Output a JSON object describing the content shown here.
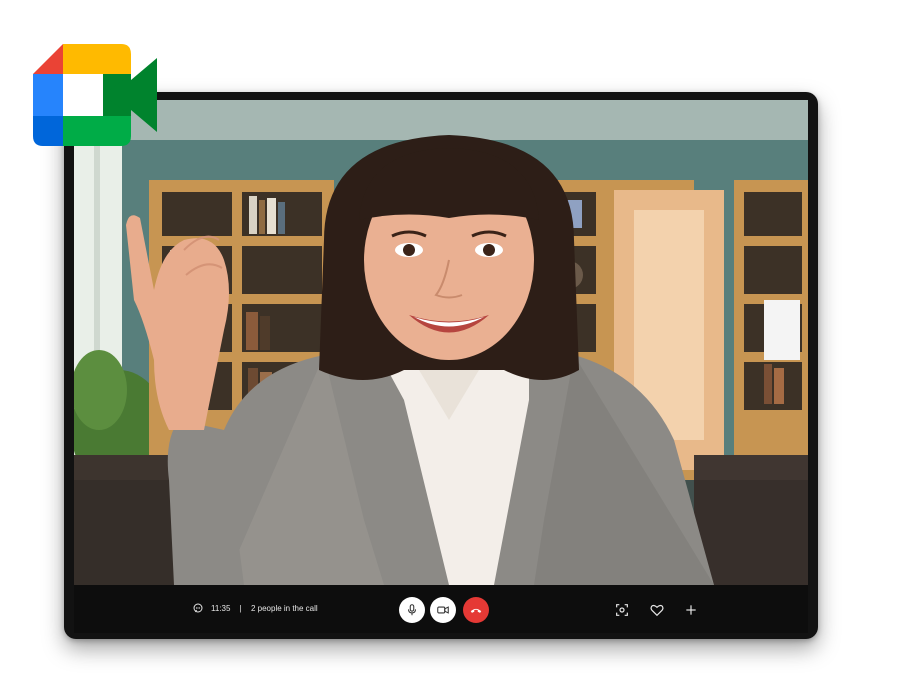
{
  "app": {
    "logo_name": "google-meet-logo"
  },
  "call": {
    "time": "11:35",
    "separator": " | ",
    "participants": "2 people in the call"
  },
  "controls": {
    "mic_icon": "microphone-icon",
    "camera_icon": "video-camera-icon",
    "end_icon": "hang-up-icon",
    "capture_icon": "screen-capture-icon",
    "react_icon": "heart-icon",
    "add_icon": "plus-icon"
  },
  "colors": {
    "end_call_red": "#e53935",
    "bar_background": "#0d0d0d",
    "meet_green": "#00832d",
    "meet_blue": "#2684fc",
    "meet_yellow": "#ffba00",
    "meet_red": "#ea4335"
  }
}
